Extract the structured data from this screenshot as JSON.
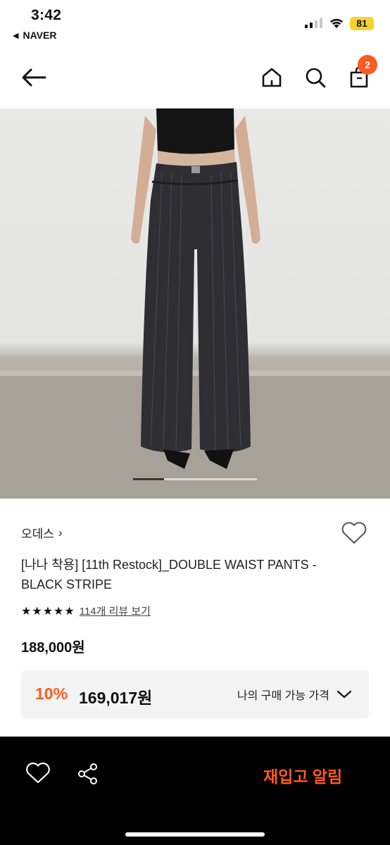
{
  "status_bar": {
    "time": "3:42",
    "back_app": "NAVER",
    "battery": "81"
  },
  "header": {
    "cart_count": "2",
    "icons": [
      "back-arrow-icon",
      "home-icon",
      "search-icon",
      "cart-icon"
    ]
  },
  "gallery": {
    "image_description_icon": "product-photo",
    "progress_fraction": 0.25
  },
  "product": {
    "brand": "오데스",
    "brand_chevron": "›",
    "title": "[나나 착용] [11th Restock]_DOUBLE WAIST PANTS - BLACK STRIPE",
    "stars": "★★★★★",
    "reviews_link": "114개 리뷰 보기",
    "price": "188,000원",
    "discount": "10%",
    "sale_price": "169,017원",
    "my_price_label": "나의 구매 가능 가격"
  },
  "bottom_bar": {
    "restock_label": "재입고 알림"
  },
  "colors": {
    "accent": "#ff5a1f",
    "bottom_bar_bg": "#000000",
    "battery": "#f6d32d"
  }
}
